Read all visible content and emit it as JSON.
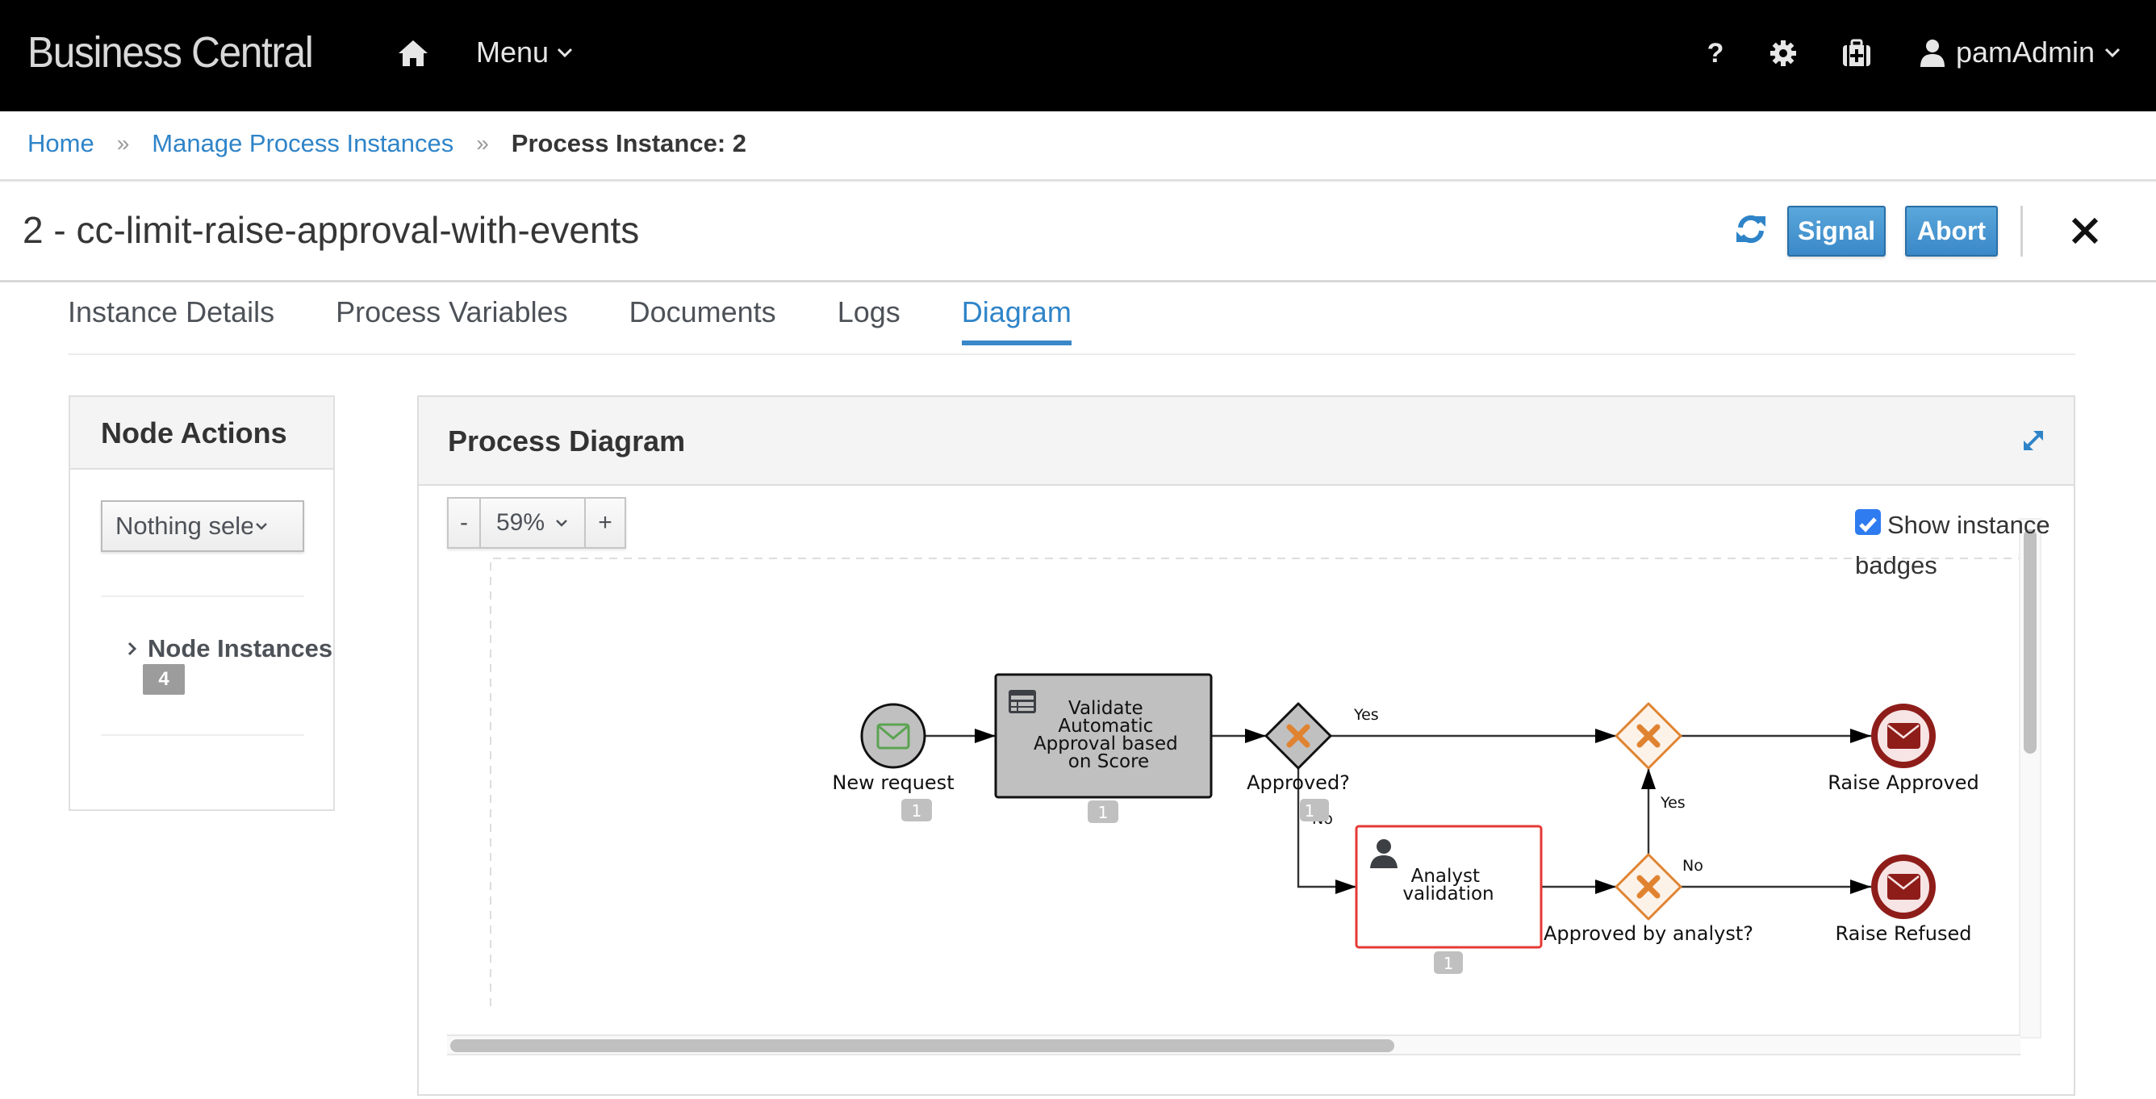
{
  "header": {
    "brand": "Business Central",
    "menu_label": "Menu",
    "icons": [
      "home-icon",
      "help-icon",
      "gear-icon",
      "medkit-icon",
      "user-icon"
    ],
    "help_label": "?",
    "user_name": "pamAdmin"
  },
  "breadcrumb": {
    "items": [
      "Home",
      "Manage Process Instances"
    ],
    "separator": "»",
    "current": "Process Instance: 2"
  },
  "instance": {
    "title": "2 - cc-limit-raise-approval-with-events",
    "signal_label": "Signal",
    "abort_label": "Abort"
  },
  "tabs": [
    {
      "label": "Instance Details",
      "active": false
    },
    {
      "label": "Process Variables",
      "active": false
    },
    {
      "label": "Documents",
      "active": false
    },
    {
      "label": "Logs",
      "active": false
    },
    {
      "label": "Diagram",
      "active": true
    }
  ],
  "node_actions": {
    "title": "Node Actions",
    "select_value": "Nothing selected",
    "tree_label": "Node Instances",
    "tree_count": "4"
  },
  "diagram_panel": {
    "title": "Process Diagram",
    "zoom_minus": "-",
    "zoom_value": "59%",
    "zoom_plus": "+",
    "show_badges_label": "Show instance badges",
    "show_badges_checked": true
  },
  "process": {
    "nodes": [
      {
        "id": "new_request",
        "type": "start-message-event",
        "label": "New request",
        "badge": "1"
      },
      {
        "id": "validate",
        "type": "business-rule-task",
        "label_lines": [
          "Validate",
          "Automatic",
          "Approval based",
          "on Score"
        ],
        "badge": "1"
      },
      {
        "id": "approved_gw",
        "type": "exclusive-gateway",
        "label": "Approved?",
        "badge": "1"
      },
      {
        "id": "analyst",
        "type": "user-task",
        "label_lines": [
          "Analyst",
          "validation"
        ],
        "badge": "1",
        "active": true
      },
      {
        "id": "merge_gw",
        "type": "exclusive-gateway",
        "label": ""
      },
      {
        "id": "analyst_gw",
        "type": "exclusive-gateway",
        "label": "Approved by analyst?"
      },
      {
        "id": "raise_approved",
        "type": "end-message-event",
        "label": "Raise Approved"
      },
      {
        "id": "raise_refused",
        "type": "end-message-event",
        "label": "Raise Refused"
      }
    ],
    "flow_labels": {
      "approved_yes": "Yes",
      "approved_no": "No",
      "analyst_yes": "Yes",
      "analyst_no": "No"
    },
    "colors": {
      "completed_fill": "#c0c0c0",
      "active_border": "#e53935",
      "gateway_orange": "#e08331",
      "end_event_red": "#8e1d1a",
      "start_icon_green": "#5ba352"
    }
  }
}
